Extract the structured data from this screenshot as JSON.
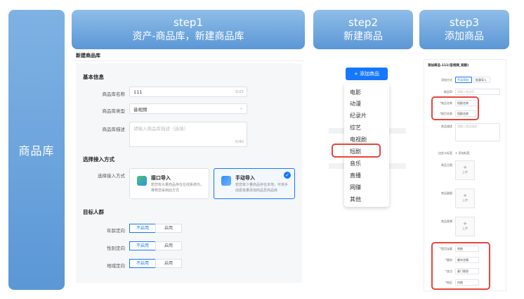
{
  "side_label": "商品库",
  "steps": [
    {
      "title": "step1",
      "subtitle": "资产-商品库，新建商品库"
    },
    {
      "title": "step2",
      "subtitle": "新建商品"
    },
    {
      "title": "step3",
      "subtitle": "添加商品"
    }
  ],
  "step1": {
    "page_title": "新建商品库",
    "basic_info_title": "基本信息",
    "name_label": "商品库名称",
    "name_value": "111",
    "name_count": "3/25",
    "type_label": "商品库类型",
    "type_value": "音视频",
    "desc_label": "商品库描述",
    "desc_placeholder": "请输入商品库描述（选填）",
    "desc_count": "0/40",
    "access_title": "选择接入方式",
    "access_label": "选择接入方式",
    "card_api_title": "接口导入",
    "card_api_desc": "若您有大量商品存在在线系统内，推荐您采用此方式",
    "card_manual_title": "手动导入",
    "card_manual_desc": "若您有少量商品存在本地，可将手动逐批量添加商品至商品库",
    "audience_title": "目标人群",
    "age_label": "年龄定向",
    "gender_label": "性别定向",
    "region_label": "地域定向",
    "opt_off": "不启用",
    "opt_on": "启用"
  },
  "step2": {
    "add_button": "+ 添加商品",
    "items": [
      "电影",
      "动漫",
      "纪录片",
      "综艺",
      "电视剧",
      "短剧",
      "音乐",
      "直播",
      "网赚",
      "其他"
    ]
  },
  "step3": {
    "title": "添加商品-111(音视频_短剧)",
    "add_method_label": "添加方式",
    "method_single": "手动添加",
    "method_batch": "批量导入",
    "product_label": "商品ID",
    "product_placeholder": "请输入商品ID",
    "product_name_label": "*商品名称",
    "product_name_value": "短剧名称",
    "series_name_label": "*剧目名称",
    "series_name_value": "短剧名称",
    "desc_label": "商品描述",
    "desc_placeholder": "请输入商品描述",
    "custom_label": "自定义标签",
    "custom_value": "+ 添加标签",
    "cover_label": "商品主图",
    "upload_text": "上传",
    "icon_label": "商品副图",
    "poster_label": "商品视频",
    "f1_label": "*是否连载",
    "f1_value": "完结",
    "f2_label": "*题材",
    "f2_value": "都市言情",
    "f3_label": "*卖点",
    "f3_value": "豪门恩怨",
    "f4_label": "*地区",
    "f4_value": "内地"
  }
}
